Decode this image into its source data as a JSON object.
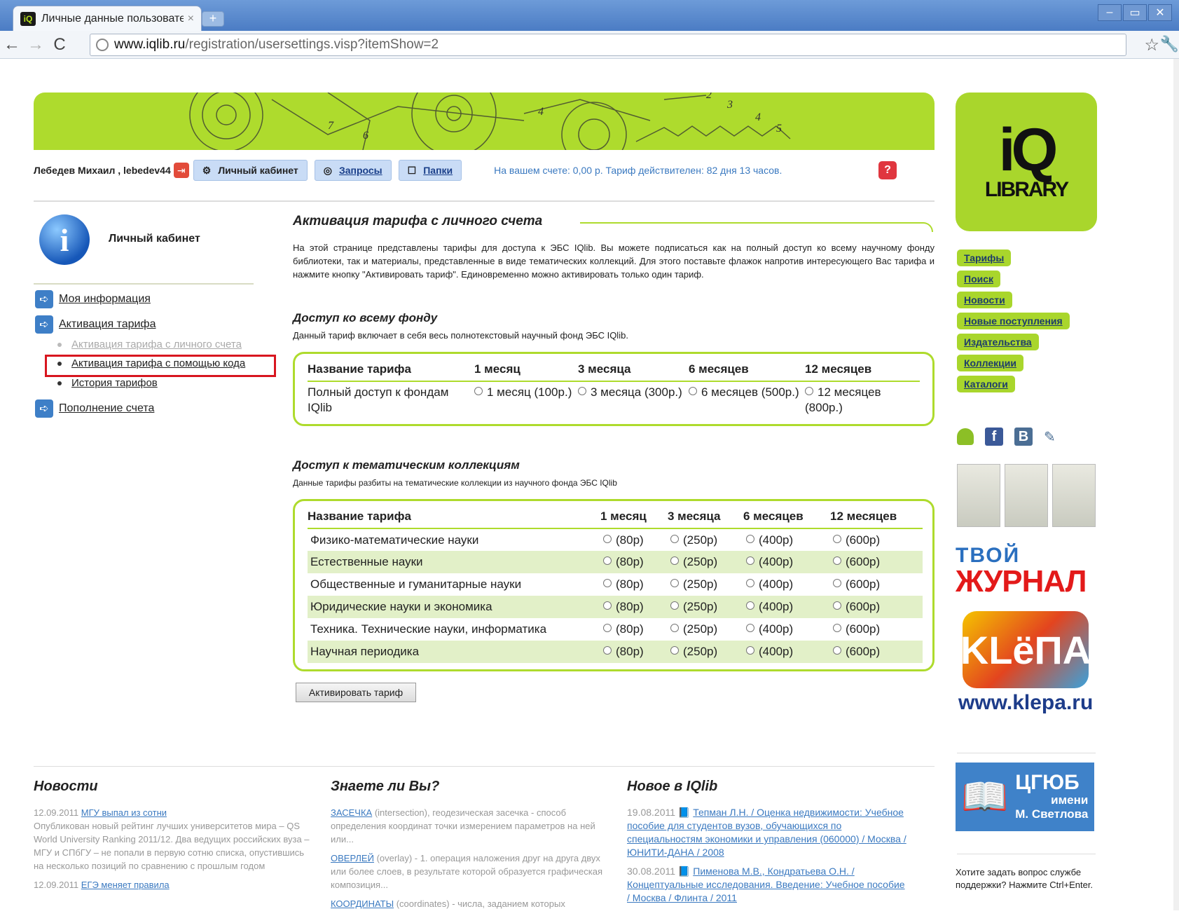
{
  "browser": {
    "tab_title": "Личные данные пользовате",
    "tab_close": "×",
    "new_tab": "+",
    "url_host": "www.iqlib.ru",
    "url_path": "/registration/usersettings.visp?itemShow=2",
    "back": "←",
    "forward": "→",
    "reload": "C",
    "star": "☆",
    "wrench": "🔧",
    "min": "–",
    "max": "▭",
    "close": "✕"
  },
  "header": {
    "user_name": "Лебедев Михаил , lebedev44",
    "cabinet_btn": "Личный кабинет",
    "requests_btn": "Запросы",
    "folders_btn": "Папки",
    "account_status": "На вашем счете: 0,00 р.   Тариф действителен: 82 дня 13 часов.",
    "help": "?"
  },
  "logo": {
    "iq": "iQ",
    "library": "LIBRARY"
  },
  "sidebar": {
    "title": "Личный кабинет",
    "info_glyph": "i",
    "items": [
      {
        "label": "Моя информация"
      },
      {
        "label": "Активация тарифа"
      },
      {
        "label": "Пополнение счета"
      }
    ],
    "sub_items": [
      {
        "label": "Активация тарифа с личного счета"
      },
      {
        "label": "Активация тарифа с помощью кода"
      },
      {
        "label": "История тарифов"
      }
    ]
  },
  "main": {
    "title": "Активация тарифа с личного счета",
    "intro": "На этой странице представлены тарифы для доступа к ЭБС IQlib. Вы можете подписаться как на полный доступ ко всему научному фонду библиотеки, так и материалы, представленные в виде тематических коллекций. Для этого поставьте флажок напротив интересующего Вас тарифа и нажмите кнопку \"Активировать тариф\". Единовременно можно активировать только один тариф.",
    "full_title": "Доступ ко всему фонду",
    "full_desc": "Данный тариф включает в себя весь полнотекстовый научный фонд ЭБС IQlib.",
    "full_table": {
      "headers": [
        "Название тарифа",
        "1 месяц",
        "3 месяца",
        "6 месяцев",
        "12 месяцев"
      ],
      "row_name": "Полный доступ к фондам IQlib",
      "options": [
        "1 месяц (100р.)",
        "3 месяца (300р.)",
        "6 месяцев (500р.)",
        "12 месяцев (800р.)"
      ]
    },
    "topic_title": "Доступ к тематическим коллекциям",
    "topic_desc": "Данные тарифы разбиты на тематические коллекции из научного фонда ЭБС IQlib",
    "topic_table": {
      "headers": [
        "Название тарифа",
        "1 месяц",
        "3 месяца",
        "6 месяцев",
        "12 месяцев"
      ],
      "prices": [
        "(80р)",
        "(250р)",
        "(400р)",
        "(600р)"
      ],
      "rows": [
        {
          "name": "Физико-математические науки"
        },
        {
          "name": "Естественные науки"
        },
        {
          "name": "Общественные и гуманитарные науки"
        },
        {
          "name": "Юридические науки и экономика"
        },
        {
          "name": "Техника. Технические науки, информатика"
        },
        {
          "name": "Научная периодика"
        }
      ]
    },
    "activate_btn": "Активировать тариф"
  },
  "right_nav": [
    "Тарифы",
    "Поиск",
    "Новости",
    "Новые поступления",
    "Издательства",
    "Коллекции",
    "Каталоги"
  ],
  "promo": {
    "tvoy": "ТВОЙ",
    "zhurnal": "ЖУРНАЛ",
    "klepa": "KLёПА",
    "klepa_url": "www.klepa.ru"
  },
  "cgyub": {
    "book": "📖",
    "name": "ЦГЮБ",
    "imeni": "имени",
    "person": "М. Светлова"
  },
  "support_text": "Хотите задать вопрос службе поддержки? Нажмите Ctrl+Enter.",
  "footer": {
    "news_title": "Новости",
    "news": [
      {
        "date": "12.09.2011",
        "link": "МГУ выпал из сотни",
        "text": "Опубликован новый рейтинг лучших университетов мира – QS World University Ranking 2011/12. Два ведущих российских вуза – МГУ и СПбГУ – не попали в первую сотню списка, опустившись на несколько позиций по сравнению с прошлым годом"
      },
      {
        "date": "12.09.2011",
        "link": "ЕГЭ меняет правила",
        "text": ""
      }
    ],
    "know_title": "Знаете ли Вы?",
    "know": [
      {
        "link": "ЗАСЕЧКА",
        "text": "(intersection), геодезическая засечка - способ определения координат точки измерением параметров на ней или..."
      },
      {
        "link": "ОВЕРЛЕЙ",
        "text": "(overlay) - 1. операция наложения друг на друга двух или более слоев, в результате которой образуется графическая композиция..."
      },
      {
        "link": "КООРДИНАТЫ",
        "text": "(coordinates) - числа, заданием которых"
      }
    ],
    "new_title": "Новое в IQlib",
    "new_items": [
      {
        "date": "19.08.2011",
        "link": "Тепман Л.Н. / Оценка недвижимости: Учебное пособие для студентов вузов, обучающихся по специальностям экономики и управления (060000) / Москва / ЮНИТИ-ДАНА / 2008"
      },
      {
        "date": "30.08.2011",
        "link": "Пименова М.В., Кондратьева О.Н. / Концептуальные исследования. Введение: Учебное пособие / Москва / Флинта / 2011"
      }
    ]
  },
  "colors": {
    "accent_green": "#aedb2d",
    "link_blue": "#3a79c0",
    "highlight_red": "#d8161f"
  }
}
